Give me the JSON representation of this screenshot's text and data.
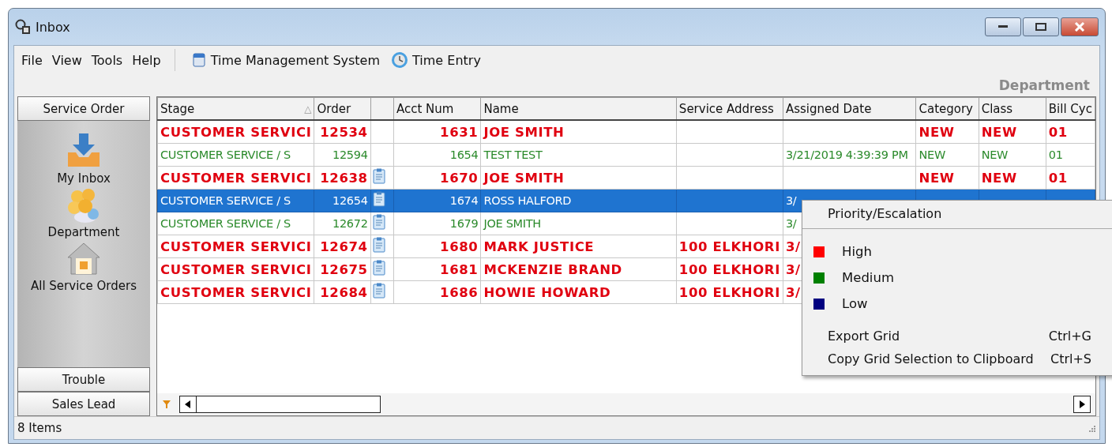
{
  "window": {
    "title": "Inbox"
  },
  "menu": [
    "File",
    "View",
    "Tools",
    "Help"
  ],
  "toolbar": [
    {
      "label": "Time Management System",
      "kind": "calendar"
    },
    {
      "label": "Time Entry",
      "kind": "clock"
    }
  ],
  "view_title": "Department",
  "nav": {
    "sections": [
      {
        "label": "Service Order",
        "expanded": true,
        "items": [
          {
            "label": "My Inbox",
            "kind": "inbox"
          },
          {
            "label": "Department",
            "kind": "people"
          },
          {
            "label": "All Service Orders",
            "kind": "house"
          }
        ]
      },
      {
        "label": "Trouble",
        "expanded": false
      },
      {
        "label": "Sales Lead",
        "expanded": false
      }
    ]
  },
  "grid": {
    "columns": [
      {
        "label": "Stage",
        "sort_indicator": "△"
      },
      {
        "label": "Order"
      },
      {},
      {
        "label": "Acct Num"
      },
      {
        "label": "Name"
      },
      {
        "label": "Service Address"
      },
      {
        "label": "Assigned Date"
      },
      {
        "label": "Category"
      },
      {
        "label": "Class"
      },
      {
        "label": "Bill Cyc"
      }
    ],
    "rows": [
      {
        "color": "#e00010",
        "bold": true,
        "selected": false,
        "note": false,
        "cells": [
          "CUSTOMER SERVICI",
          "12534",
          "",
          "1631",
          "JOE SMITH",
          "",
          "",
          "NEW",
          "NEW",
          "01"
        ]
      },
      {
        "color": "#2b8a2b",
        "bold": false,
        "selected": false,
        "note": false,
        "cells": [
          "CUSTOMER SERVICE / S",
          "12594",
          "",
          "1654",
          "TEST TEST",
          "",
          "3/21/2019 4:39:39 PM",
          "NEW",
          "NEW",
          "01"
        ]
      },
      {
        "color": "#e00010",
        "bold": true,
        "selected": false,
        "note": true,
        "cells": [
          "CUSTOMER SERVICI",
          "12638",
          "",
          "1670",
          "JOE SMITH",
          "",
          "",
          "NEW",
          "NEW",
          "01"
        ]
      },
      {
        "bold": false,
        "selected": true,
        "note": true,
        "cells": [
          "CUSTOMER SERVICE / S",
          "12654",
          "",
          "1674",
          "ROSS HALFORD",
          "",
          "3/"
        ]
      },
      {
        "color": "#2b8a2b",
        "bold": false,
        "selected": false,
        "note": true,
        "cells": [
          "CUSTOMER SERVICE / S",
          "12672",
          "",
          "1679",
          "JOE SMITH",
          "",
          "3/"
        ]
      },
      {
        "color": "#e00010",
        "bold": true,
        "selected": false,
        "note": true,
        "cells": [
          "CUSTOMER SERVICI",
          "12674",
          "",
          "1680",
          "MARK JUSTICE",
          "100 ELKHORI",
          "3/"
        ]
      },
      {
        "color": "#e00010",
        "bold": true,
        "selected": false,
        "note": true,
        "cells": [
          "CUSTOMER SERVICI",
          "12675",
          "",
          "1681",
          "MCKENZIE BRAND",
          "100 ELKHORI",
          "3/"
        ]
      },
      {
        "color": "#e00010",
        "bold": true,
        "selected": false,
        "note": true,
        "cells": [
          "CUSTOMER SERVICI",
          "12684",
          "",
          "1686",
          "HOWIE HOWARD",
          "100 ELKHORI",
          "3/"
        ]
      }
    ]
  },
  "context_menu": {
    "title": "Priority/Escalation",
    "priorities": [
      {
        "label": "High",
        "color": "#ff0000"
      },
      {
        "label": "Medium",
        "color": "#008000"
      },
      {
        "label": "Low",
        "color": "#000080"
      }
    ],
    "actions": [
      {
        "label": "Export Grid",
        "shortcut": "Ctrl+G"
      },
      {
        "label": "Copy Grid Selection to Clipboard",
        "shortcut": "Ctrl+S"
      }
    ]
  },
  "status_bar": {
    "text": "8 Items"
  }
}
